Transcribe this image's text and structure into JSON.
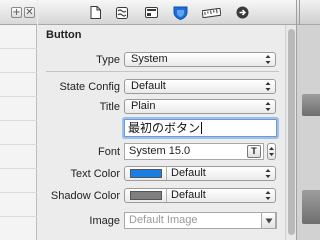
{
  "left_strip": {
    "add_glyph": "+",
    "remove_glyph": "✕"
  },
  "toolbar": {
    "tabs": [
      {
        "name": "file-inspector",
        "icon": "document-icon"
      },
      {
        "name": "quick-help",
        "icon": "wave-icon"
      },
      {
        "name": "identity",
        "icon": "identity-card-icon"
      },
      {
        "name": "attributes",
        "icon": "shield-icon",
        "selected": true
      },
      {
        "name": "size",
        "icon": "ruler-icon"
      },
      {
        "name": "connections",
        "icon": "arrow-circle-icon"
      }
    ]
  },
  "section": {
    "title": "Button"
  },
  "fields": {
    "type": {
      "label": "Type",
      "value": "System"
    },
    "state_config": {
      "label": "State Config",
      "value": "Default"
    },
    "title": {
      "label": "Title",
      "value": "Plain"
    },
    "title_text": {
      "value": "最初のボタン"
    },
    "font": {
      "label": "Font",
      "value": "System 15.0",
      "button_glyph": "T"
    },
    "text_color": {
      "label": "Text Color",
      "value": "Default",
      "swatch": "#1a7fe5"
    },
    "shadow_color": {
      "label": "Shadow Color",
      "value": "Default",
      "swatch": "#7f7f7f"
    },
    "image": {
      "label": "Image",
      "placeholder": "Default Image"
    }
  },
  "colors": {
    "accent": "#1a7fe5",
    "focus_ring": "#9cc0ea",
    "window_bg": "#ececec"
  }
}
